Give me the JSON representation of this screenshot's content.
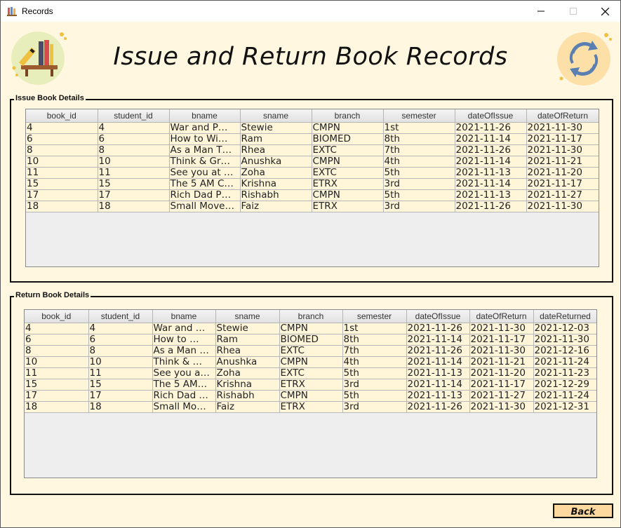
{
  "window": {
    "title": "Records"
  },
  "heading": "Issue and Return Book Records",
  "issue_section": {
    "legend": "Issue Book Details",
    "columns": [
      "book_id",
      "student_id",
      "bname",
      "sname",
      "branch",
      "semester",
      "dateOfIssue",
      "dateOfReturn"
    ],
    "rows": [
      [
        "4",
        "4",
        "War and P…",
        "Stewie",
        "CMPN",
        "1st",
        "2021-11-26",
        "2021-11-30"
      ],
      [
        "6",
        "6",
        "How to Wi…",
        "Ram",
        "BIOMED",
        "8th",
        "2021-11-14",
        "2021-11-17"
      ],
      [
        "8",
        "8",
        "As a Man T…",
        "Rhea",
        "EXTC",
        "7th",
        "2021-11-26",
        "2021-11-30"
      ],
      [
        "10",
        "10",
        "Think & Gr…",
        "Anushka",
        "CMPN",
        "4th",
        "2021-11-14",
        "2021-11-21"
      ],
      [
        "11",
        "11",
        "See you at …",
        "Zoha",
        "EXTC",
        "5th",
        "2021-11-13",
        "2021-11-20"
      ],
      [
        "15",
        "15",
        "The 5 AM C…",
        "Krishna",
        "ETRX",
        "3rd",
        "2021-11-14",
        "2021-11-17"
      ],
      [
        "17",
        "17",
        "Rich Dad P…",
        "Rishabh",
        "CMPN",
        "5th",
        "2021-11-13",
        "2021-11-27"
      ],
      [
        "18",
        "18",
        "Small Move…",
        "Faiz",
        "ETRX",
        "3rd",
        "2021-11-26",
        "2021-11-30"
      ]
    ]
  },
  "return_section": {
    "legend": "Return Book Details",
    "columns": [
      "book_id",
      "student_id",
      "bname",
      "sname",
      "branch",
      "semester",
      "dateOfIssue",
      "dateOfReturn",
      "dateReturned"
    ],
    "rows": [
      [
        "4",
        "4",
        "War and …",
        "Stewie",
        "CMPN",
        "1st",
        "2021-11-26",
        "2021-11-30",
        "2021-12-03"
      ],
      [
        "6",
        "6",
        "How to …",
        "Ram",
        "BIOMED",
        "8th",
        "2021-11-14",
        "2021-11-17",
        "2021-11-30"
      ],
      [
        "8",
        "8",
        "As a Man …",
        "Rhea",
        "EXTC",
        "7th",
        "2021-11-26",
        "2021-11-30",
        "2021-12-16"
      ],
      [
        "10",
        "10",
        "Think & …",
        "Anushka",
        "CMPN",
        "4th",
        "2021-11-14",
        "2021-11-21",
        "2021-11-24"
      ],
      [
        "11",
        "11",
        "See you a…",
        "Zoha",
        "EXTC",
        "5th",
        "2021-11-13",
        "2021-11-20",
        "2021-11-23"
      ],
      [
        "15",
        "15",
        "The 5 AM…",
        "Krishna",
        "ETRX",
        "3rd",
        "2021-11-14",
        "2021-11-17",
        "2021-12-29"
      ],
      [
        "17",
        "17",
        "Rich Dad …",
        "Rishabh",
        "CMPN",
        "5th",
        "2021-11-13",
        "2021-11-27",
        "2021-11-24"
      ],
      [
        "18",
        "18",
        "Small Mo…",
        "Faiz",
        "ETRX",
        "3rd",
        "2021-11-26",
        "2021-11-30",
        "2021-12-31"
      ]
    ]
  },
  "back_label": "Back",
  "icons": {
    "left_logo": "bookshelf-icon",
    "right_logo": "refresh-cycle-icon",
    "app": "books-icon"
  }
}
